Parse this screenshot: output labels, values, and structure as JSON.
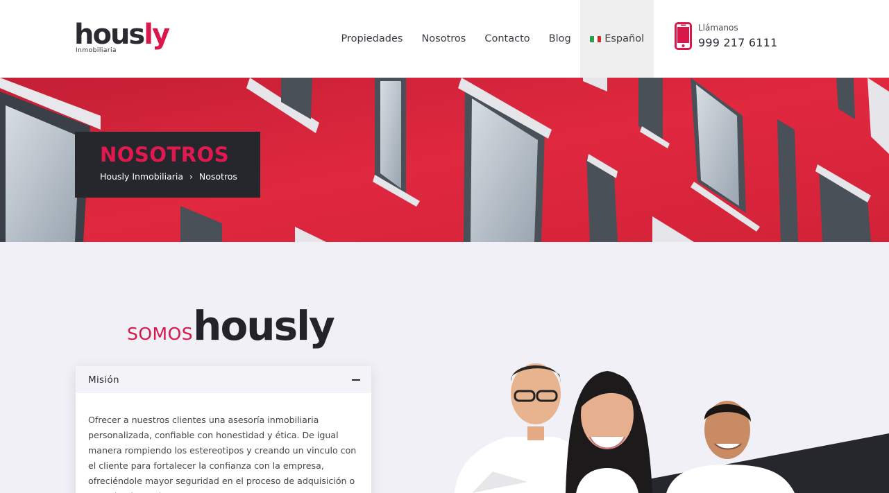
{
  "header": {
    "logo": {
      "word_main": "hous",
      "word_accent": "ly",
      "subtitle": "Inmobiliaria"
    },
    "nav": [
      {
        "label": "Propiedades"
      },
      {
        "label": "Nosotros"
      },
      {
        "label": "Contacto"
      },
      {
        "label": "Blog"
      }
    ],
    "language": {
      "label": "Español",
      "flag_colors": [
        "#2e9e4f",
        "#ffffff",
        "#d32a2a"
      ]
    },
    "phone": {
      "label": "Llámanos",
      "number": "999 217 6111",
      "icon": "mobile-phone-icon"
    }
  },
  "hero": {
    "title": "NOSOTROS",
    "breadcrumb": [
      "Hously Inmobiliaria",
      "Nosotros"
    ],
    "separator": "›"
  },
  "about": {
    "heading_small": "SOMOS",
    "heading_big": "hously",
    "accordion": {
      "title": "Misión",
      "body": "Ofrecer a nuestros clientes una asesoría inmobiliaria personalizada, confiable con honestidad y ética. De igual manera rompiendo los estereotipos y creando un vinculo con el cliente para fortalecer la confianza con la empresa, ofreciéndole mayor seguridad en el proceso de adquisición o arrendamiento de un"
    }
  },
  "colors": {
    "accent": "#d8184a",
    "dark": "#26272d",
    "background": "#f1f0f6"
  }
}
